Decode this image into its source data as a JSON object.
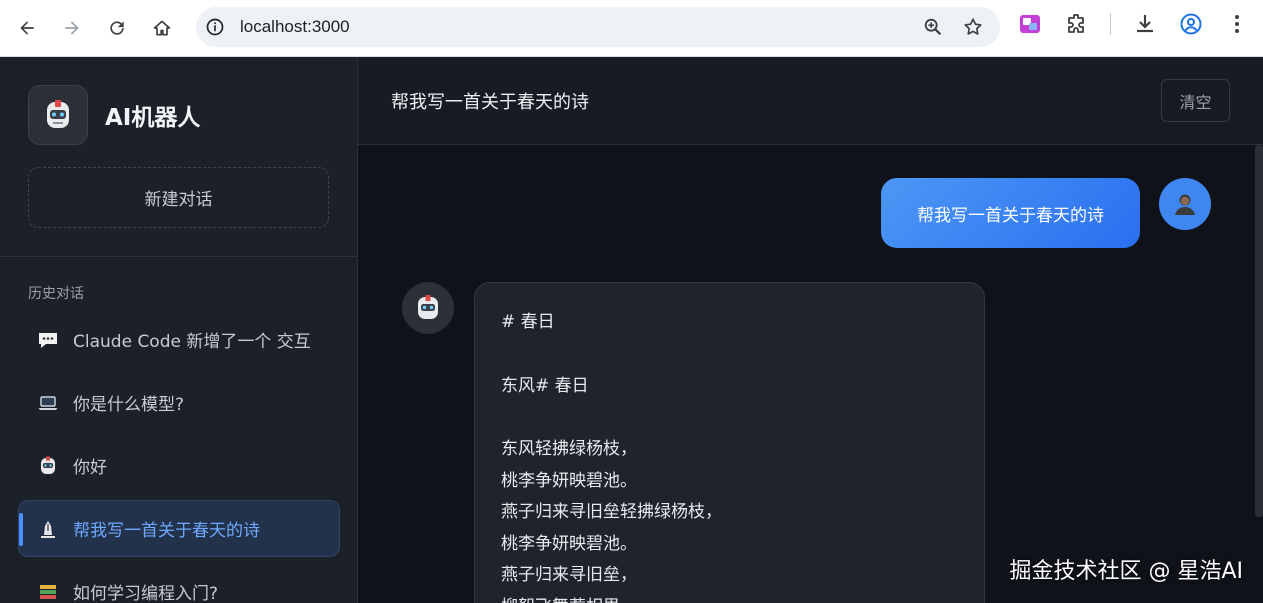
{
  "browser": {
    "url": "localhost:3000"
  },
  "sidebar": {
    "brand_title": "AI机器人",
    "new_chat_label": "新建对话",
    "history_label": "历史对话",
    "items": [
      {
        "label": "Claude Code 新增了一个 交互",
        "icon": "speech-bubble-icon",
        "active": false
      },
      {
        "label": "你是什么模型?",
        "icon": "laptop-icon",
        "active": false
      },
      {
        "label": "你好",
        "icon": "robot-icon",
        "active": false
      },
      {
        "label": "帮我写一首关于春天的诗",
        "icon": "pen-icon",
        "active": true
      },
      {
        "label": "如何学习编程入门?",
        "icon": "books-icon",
        "active": false
      }
    ]
  },
  "main": {
    "title": "帮我写一首关于春天的诗",
    "clear_label": "清空",
    "user_message": "帮我写一首关于春天的诗",
    "bot_lines": {
      "l1": "# 春日",
      "l2": "东风# 春日",
      "l3": "东风轻拂绿杨枝，",
      "l4": "桃李争妍映碧池。",
      "l5": "燕子归来寻旧垒轻拂绿杨枝，",
      "l6": "桃李争妍映碧池。",
      "l7": "燕子归来寻旧垒，",
      "l8": "柳絮飞舞惹相思"
    }
  },
  "watermark": "掘金技术社区 @ 星浩AI",
  "colors": {
    "accent": "#4d8eff",
    "user_bubble": "#3f86f0",
    "sidebar_bg": "#1b2029",
    "main_bg": "#0f1218"
  }
}
